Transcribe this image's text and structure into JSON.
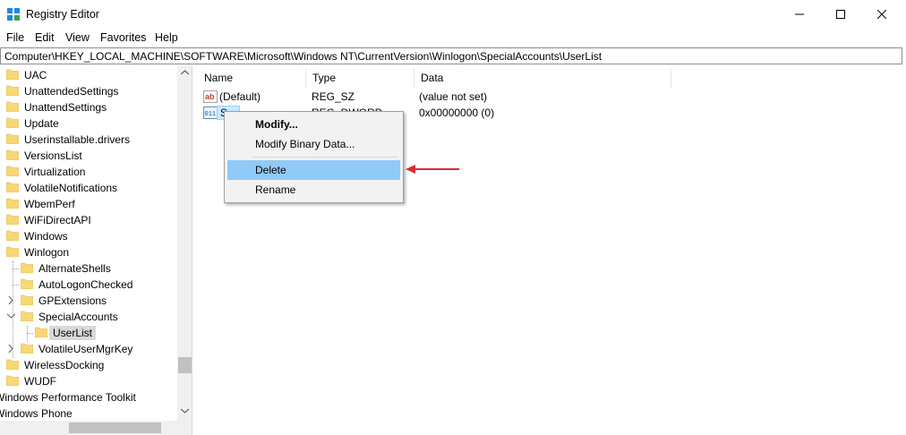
{
  "window": {
    "title": "Registry Editor",
    "icon": "registry-editor-icon",
    "controls": [
      "minimize-icon",
      "maximize-icon",
      "close-icon"
    ]
  },
  "menu": [
    "File",
    "Edit",
    "View",
    "Favorites",
    "Help"
  ],
  "address": "Computer\\HKEY_LOCAL_MACHINE\\SOFTWARE\\Microsoft\\Windows NT\\CurrentVersion\\Winlogon\\SpecialAccounts\\UserList",
  "tree": [
    {
      "label": "UAC"
    },
    {
      "label": "UnattendedSettings"
    },
    {
      "label": "UnattendSettings"
    },
    {
      "label": "Update"
    },
    {
      "label": "Userinstallable.drivers"
    },
    {
      "label": "VersionsList"
    },
    {
      "label": "Virtualization"
    },
    {
      "label": "VolatileNotifications"
    },
    {
      "label": "WbemPerf"
    },
    {
      "label": "WiFiDirectAPI"
    },
    {
      "label": "Windows"
    },
    {
      "label": "Winlogon"
    },
    {
      "label": "AlternateShells"
    },
    {
      "label": "AutoLogonChecked"
    },
    {
      "label": "GPExtensions"
    },
    {
      "label": "SpecialAccounts"
    },
    {
      "label": "UserList"
    },
    {
      "label": "VolatileUserMgrKey"
    },
    {
      "label": "WirelessDocking"
    },
    {
      "label": "WUDF"
    },
    {
      "label": "Windows Performance Toolkit"
    },
    {
      "label": "Windows Phone"
    }
  ],
  "columns": [
    "Name",
    "Type",
    "Data"
  ],
  "values": [
    {
      "name": "(Default)",
      "type": "REG_SZ",
      "data": "(value not set)",
      "icon": "string-value-icon"
    },
    {
      "name": "S...",
      "type": "REG_DWORD",
      "data": "0x00000000 (0)",
      "icon": "binary-value-icon"
    }
  ],
  "context_menu": {
    "items": [
      "Modify...",
      "Modify Binary Data...",
      "Delete",
      "Rename"
    ],
    "highlighted": "Delete"
  },
  "colors": {
    "selection": "#cce8ff",
    "menu_hover": "#91c9f7",
    "folder": "#f8d775",
    "annotation_arrow": "#d32f2f"
  }
}
